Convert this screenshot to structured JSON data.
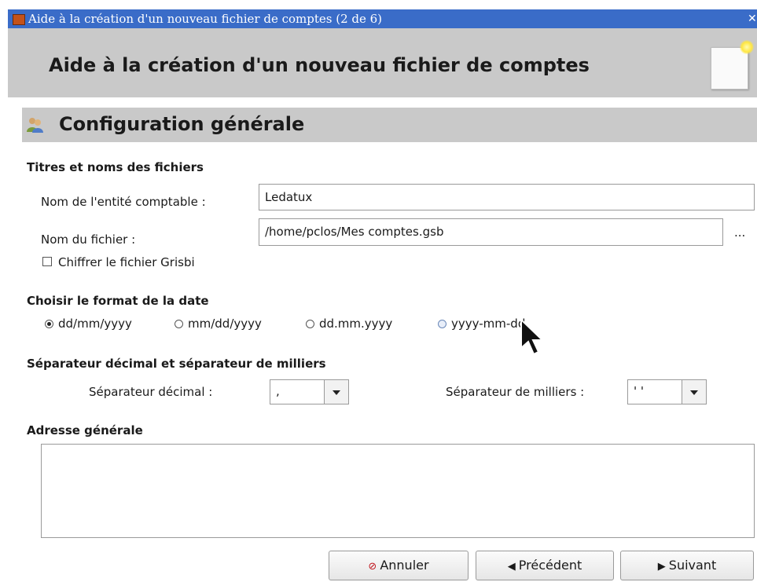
{
  "window": {
    "title": "Aide à la création d'un nouveau fichier de comptes (2 de 6)"
  },
  "header": {
    "title": "Aide à la création d'un nouveau fichier de comptes"
  },
  "section": {
    "title": "Configuration générale"
  },
  "titles_group": {
    "heading": "Titres et noms des fichiers",
    "entity_label": "Nom de l'entité comptable :",
    "entity_value": "Ledatux",
    "filename_label": "Nom du fichier :",
    "filename_value": "/home/pclos/Mes comptes.gsb",
    "browse_label": "...",
    "encrypt_label": "Chiffrer le fichier Grisbi"
  },
  "date_group": {
    "heading": "Choisir le format de la date",
    "options": [
      "dd/mm/yyyy",
      "mm/dd/yyyy",
      "dd.mm.yyyy",
      "yyyy-mm-dd."
    ],
    "selected": "dd/mm/yyyy"
  },
  "separator_group": {
    "heading": "Séparateur décimal et séparateur de milliers",
    "decimal_label": "Séparateur décimal :",
    "decimal_value": ",",
    "thousands_label": "Séparateur de milliers :",
    "thousands_value": "' '"
  },
  "address_group": {
    "heading": "Adresse générale"
  },
  "buttons": {
    "cancel": "Annuler",
    "previous": "Précédent",
    "next": "Suivant"
  },
  "icons": [
    "app-icon",
    "close-icon",
    "new-document-icon",
    "users-icon",
    "cancel-icon",
    "arrow-left-icon",
    "arrow-right-icon",
    "mouse-cursor-icon"
  ]
}
